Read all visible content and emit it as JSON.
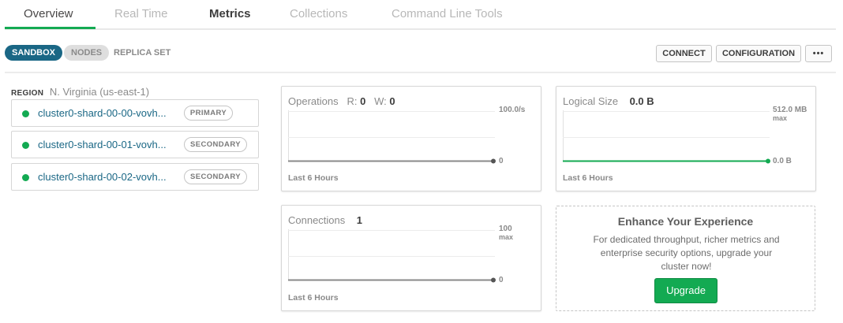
{
  "tabs": [
    {
      "label": "Overview"
    },
    {
      "label": "Real Time"
    },
    {
      "label": "Metrics"
    },
    {
      "label": "Collections"
    },
    {
      "label": "Command Line Tools"
    }
  ],
  "cluster_type": {
    "sandbox": "SANDBOX",
    "nodes": "NODES",
    "replica_set": "REPLICA SET"
  },
  "actions": {
    "connect": "CONNECT",
    "configuration": "CONFIGURATION",
    "more": "•••"
  },
  "region": {
    "label": "REGION",
    "value": "N. Virginia (us-east-1)"
  },
  "nodes": [
    {
      "name": "cluster0-shard-00-00-vovh...",
      "role": "PRIMARY",
      "status_color": "#13aa52"
    },
    {
      "name": "cluster0-shard-00-01-vovh...",
      "role": "SECONDARY",
      "status_color": "#13aa52"
    },
    {
      "name": "cluster0-shard-00-02-vovh...",
      "role": "SECONDARY",
      "status_color": "#13aa52"
    }
  ],
  "metrics": {
    "operations": {
      "title": "Operations",
      "r_label": "R:",
      "r_value": "0",
      "w_label": "W:",
      "w_value": "0",
      "max_label": "100.0/s",
      "zero_label": "0",
      "footer": "Last 6 Hours"
    },
    "logical_size": {
      "title": "Logical Size",
      "value": "0.0 B",
      "max_label": "512.0 MB",
      "max_sub": "max",
      "current_label": "0.0 B",
      "footer": "Last 6 Hours",
      "line_color": "#13aa52"
    },
    "connections": {
      "title": "Connections",
      "value": "1",
      "max_label": "100",
      "max_sub": "max",
      "zero_label": "0",
      "footer": "Last 6 Hours"
    }
  },
  "upgrade": {
    "title": "Enhance Your Experience",
    "text": "For dedicated throughput, richer metrics and enterprise security options, upgrade your cluster now!",
    "button": "Upgrade"
  },
  "colors": {
    "accent_green": "#13aa52",
    "brand_blue": "#1a6785"
  }
}
